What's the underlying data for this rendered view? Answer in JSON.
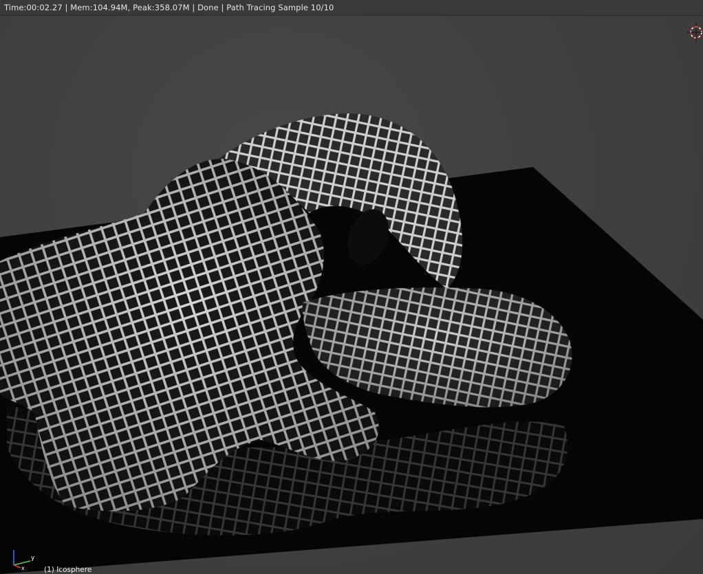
{
  "header": {
    "render_status": "Time:00:02.27 | Mem:104.94M, Peak:358.07M | Done | Path Tracing Sample 10/10"
  },
  "viewport": {
    "active_object_label": "(1) Icosphere",
    "axis_labels": {
      "x": "x",
      "y": "y"
    }
  },
  "colors": {
    "background": "#3f3f3f",
    "floor": "#050505",
    "mesh": "#d8d8d8",
    "cursor_ring": "#cc2222"
  },
  "icons": [
    "3d-cursor-icon",
    "axis-gizmo-icon"
  ]
}
